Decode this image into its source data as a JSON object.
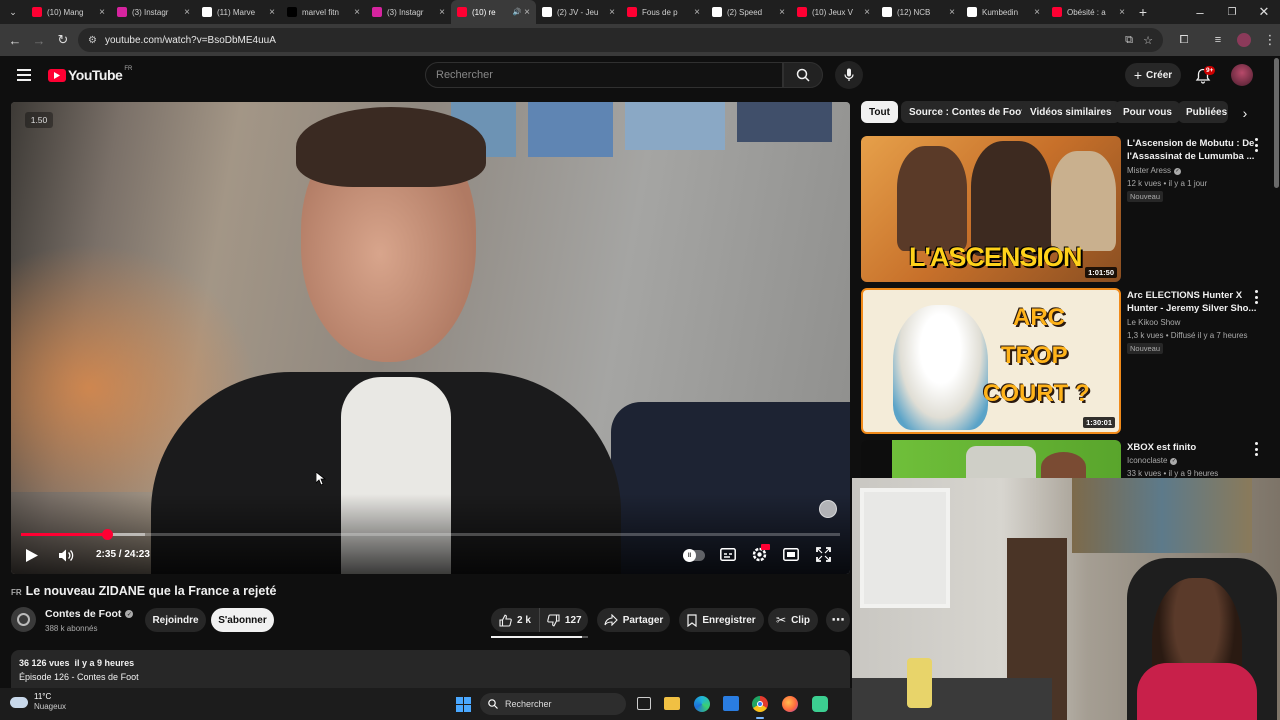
{
  "browser": {
    "tabs": [
      {
        "label": "(10) Mang",
        "fav_color": "#ff0033"
      },
      {
        "label": "(3) Instagr",
        "fav_color": "#d6249f"
      },
      {
        "label": "(11) Marve",
        "fav_color": "#ffffff"
      },
      {
        "label": "marvel fitn",
        "fav_color": "#000000"
      },
      {
        "label": "(3) Instagr",
        "fav_color": "#d6249f"
      },
      {
        "label": "(10) re",
        "fav_color": "#ff0033",
        "active": true
      },
      {
        "label": "(2) JV - Jeu",
        "fav_color": "#ffffff"
      },
      {
        "label": "Fous de p",
        "fav_color": "#ff0033"
      },
      {
        "label": "(2) Speed",
        "fav_color": "#ffffff"
      },
      {
        "label": "(10) Jeux V",
        "fav_color": "#ff0033"
      },
      {
        "label": "(12) NCB",
        "fav_color": "#ffffff"
      },
      {
        "label": "Kumbedin",
        "fav_color": "#ffffff"
      },
      {
        "label": "Obésité : a",
        "fav_color": "#ff0033"
      }
    ],
    "url": "youtube.com/watch?v=BsoDbME4uuA"
  },
  "header": {
    "logo_text": "YouTube",
    "region": "FR",
    "search_placeholder": "Rechercher",
    "create_label": "Créer",
    "notif_count": "9+"
  },
  "player": {
    "speed_indicator": "1.50",
    "time": "2:35 / 24:23",
    "progress_fraction": 0.106,
    "buffered_fraction": 0.152
  },
  "video": {
    "lang_tag": "FR",
    "title": "Le nouveau ZIDANE que la France a rejeté",
    "channel": "Contes de Foot",
    "subscribers": "388 k abonnés",
    "join_label": "Rejoindre",
    "subscribe_label": "S'abonner",
    "likes": "2 k",
    "dislikes": "127",
    "share_label": "Partager",
    "save_label": "Enregistrer",
    "clip_label": "Clip",
    "views_line": "36 126 vues  il y a 9 heures",
    "description_line": "Épisode 126 - Contes de Foot"
  },
  "chips": [
    "Tout",
    "Source : Contes de Foot",
    "Vidéos similaires",
    "Pour vous",
    "Publiées"
  ],
  "recommendations": [
    {
      "title_line1": "L'Ascension de Mobutu : De",
      "title_line2": "l'Assassinat de Lumumba ...",
      "channel": "Mister Aress",
      "meta": "12 k vues • il y a 1 jour",
      "badge": "Nouveau",
      "duration": "1:01:50",
      "thumb_text": "L'ASCENSION"
    },
    {
      "title_line1": "Arc ELECTIONS Hunter X",
      "title_line2": "Hunter - Jeremy Silver Sho...",
      "channel": "Le Kikoo Show",
      "meta": "1,3 k vues • Diffusé il y a 7 heures",
      "badge": "Nouveau",
      "duration": "1:30:01",
      "thumb_line1": "ARC",
      "thumb_line2": "TROP",
      "thumb_line3": "COURT ?"
    },
    {
      "title_line1": "XBOX est finito",
      "channel": "Iconoclaste",
      "meta": "33 k vues • il y a 9 heures"
    }
  ],
  "taskbar": {
    "temperature": "11°C",
    "weather": "Nuageux",
    "search_label": "Rechercher"
  },
  "colors": {
    "yt_red": "#ff0033",
    "bg": "#0f0f0f",
    "chip_bg": "#272727"
  }
}
